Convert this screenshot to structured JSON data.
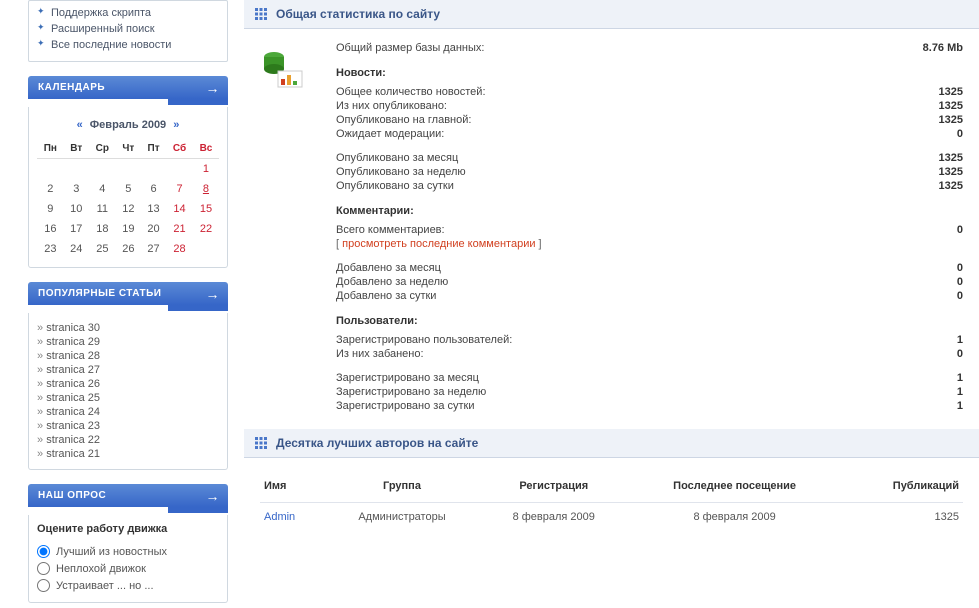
{
  "sidebar": {
    "top_menu": [
      "Поддержка скрипта",
      "Расширенный поиск",
      "Все последние новости"
    ],
    "calendar": {
      "title": "КАЛЕНДАРЬ",
      "month": "Февраль 2009",
      "prev": "«",
      "next": "»",
      "headers": [
        "Пн",
        "Вт",
        "Ср",
        "Чт",
        "Пт",
        "Сб",
        "Вс"
      ],
      "weeks": [
        [
          "",
          "",
          "",
          "",
          "",
          "",
          {
            "d": "1",
            "w": true
          }
        ],
        [
          "2",
          "3",
          "4",
          "5",
          "6",
          {
            "d": "7",
            "w": true
          },
          {
            "d": "8",
            "w": true,
            "link": true
          }
        ],
        [
          "9",
          "10",
          "11",
          "12",
          "13",
          {
            "d": "14",
            "w": true
          },
          {
            "d": "15",
            "w": true
          }
        ],
        [
          "16",
          "17",
          "18",
          "19",
          "20",
          {
            "d": "21",
            "w": true
          },
          {
            "d": "22",
            "w": true
          }
        ],
        [
          "23",
          "24",
          "25",
          "26",
          "27",
          {
            "d": "28",
            "w": true
          },
          ""
        ]
      ]
    },
    "popular": {
      "title": "ПОПУЛЯРНЫЕ СТАТЬИ",
      "items": [
        "stranica 30",
        "stranica 29",
        "stranica 28",
        "stranica 27",
        "stranica 26",
        "stranica 25",
        "stranica 24",
        "stranica 23",
        "stranica 22",
        "stranica 21"
      ]
    },
    "poll": {
      "title": "НАШ ОПРОС",
      "question": "Оцените работу движка",
      "options": [
        "Лучший из новостных",
        "Неплохой движок",
        "Устраивает ... но ..."
      ]
    }
  },
  "stats_panel": {
    "title": "Общая статистика по сайту",
    "db_size": {
      "label": "Общий размер базы данных:",
      "value": "8.76 Mb"
    },
    "news": {
      "heading": "Новости:",
      "rows": [
        {
          "label": "Общее количество новостей:",
          "value": "1325"
        },
        {
          "label": "Из них опубликовано:",
          "value": "1325"
        },
        {
          "label": "Опубликовано на главной:",
          "value": "1325"
        },
        {
          "label": "Ожидает модерации:",
          "value": "0"
        }
      ],
      "rows2": [
        {
          "label": "Опубликовано за месяц",
          "value": "1325"
        },
        {
          "label": "Опубликовано за неделю",
          "value": "1325"
        },
        {
          "label": "Опубликовано за сутки",
          "value": "1325"
        }
      ]
    },
    "comments": {
      "heading": "Комментарии:",
      "total": {
        "label": "Всего комментариев:",
        "value": "0"
      },
      "link": "просмотреть последние комментарии",
      "rows": [
        {
          "label": "Добавлено за месяц",
          "value": "0"
        },
        {
          "label": "Добавлено за неделю",
          "value": "0"
        },
        {
          "label": "Добавлено за сутки",
          "value": "0"
        }
      ]
    },
    "users": {
      "heading": "Пользователи:",
      "rows": [
        {
          "label": "Зарегистрировано пользователей:",
          "value": "1"
        },
        {
          "label": "Из них забанено:",
          "value": "0"
        }
      ],
      "rows2": [
        {
          "label": "Зарегистрировано за месяц",
          "value": "1"
        },
        {
          "label": "Зарегистрировано за неделю",
          "value": "1"
        },
        {
          "label": "Зарегистрировано за сутки",
          "value": "1"
        }
      ]
    }
  },
  "authors_panel": {
    "title": "Десятка лучших авторов на сайте",
    "headers": {
      "name": "Имя",
      "group": "Группа",
      "reg": "Регистрация",
      "last": "Последнее посещение",
      "pub": "Публикаций"
    },
    "rows": [
      {
        "name": "Admin",
        "group": "Администраторы",
        "reg": "8 февраля 2009",
        "last": "8 февраля 2009",
        "pub": "1325"
      }
    ]
  }
}
